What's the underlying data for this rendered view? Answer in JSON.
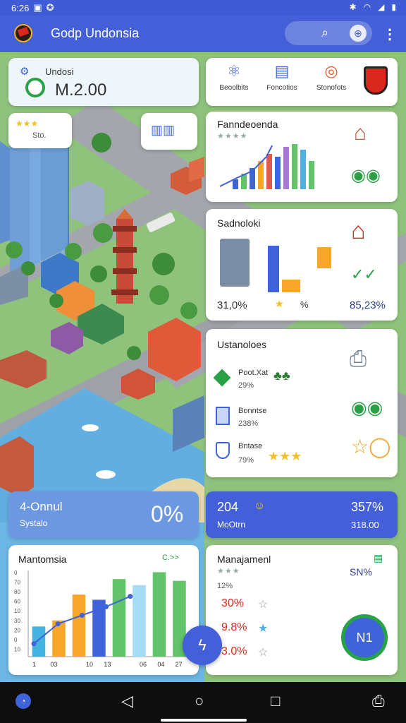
{
  "status": {
    "time": "6:26"
  },
  "app": {
    "title": "Godp Undonsia"
  },
  "score_card": {
    "label": "Undosi",
    "value": "M.2.00"
  },
  "categories": [
    {
      "label": "Beoolbits"
    },
    {
      "label": "Foncotios"
    },
    {
      "label": "Stonofots"
    }
  ],
  "map_badge": {
    "label": "Sto."
  },
  "card_ranking": {
    "title": "Fanndeoenda",
    "bars": [
      30,
      55,
      70,
      85,
      78,
      95,
      68,
      60
    ]
  },
  "card_stats": {
    "title": "Sadnoloki",
    "left_pct": "31,0%",
    "mid_pct": "%",
    "right_pct": "85,23%"
  },
  "card_list": {
    "title": "Ustanoloes",
    "items": [
      {
        "name": "Poot.Xat",
        "pct": "29%"
      },
      {
        "name": "Bonntse",
        "pct": "238%"
      },
      {
        "name": "Bntase",
        "pct": "79%"
      }
    ]
  },
  "tile_left": {
    "title": "4-Onnul",
    "sub": "Systalo",
    "pct": "0%"
  },
  "tile_right": {
    "title": "204",
    "sub": "MoOtrn",
    "pct": "357%",
    "value": "318.00"
  },
  "chart_card": {
    "title": "Mantomsia",
    "legend": "C.>>"
  },
  "chart_data": {
    "type": "bar",
    "title": "Mantomsia",
    "categories": [
      "1",
      "03",
      "",
      "10",
      "13",
      "",
      "06",
      "04",
      "27"
    ],
    "values": [
      35,
      42,
      72,
      66,
      90,
      83,
      98,
      88
    ],
    "line": [
      15,
      38,
      48,
      58,
      70
    ],
    "ylim": [
      0,
      100
    ],
    "yticks": [
      "0",
      "70",
      "80",
      "60",
      "10",
      "30",
      "20",
      "0",
      "10"
    ],
    "colors": [
      "#45b3e0",
      "#f7a62a",
      "#f7a62a",
      "#3f63d8",
      "#62c36b",
      "#a6dcf4",
      "#62c36b",
      "#62c36b"
    ]
  },
  "mgmt_card": {
    "title": "Manajamenl",
    "pct_top": "12%",
    "rate": "SN%",
    "items": [
      "30%",
      "9.8%",
      "3.0%"
    ],
    "fab": "N1"
  },
  "colors": {
    "primary": "#4460d8",
    "accent": "#3f5bd6"
  }
}
